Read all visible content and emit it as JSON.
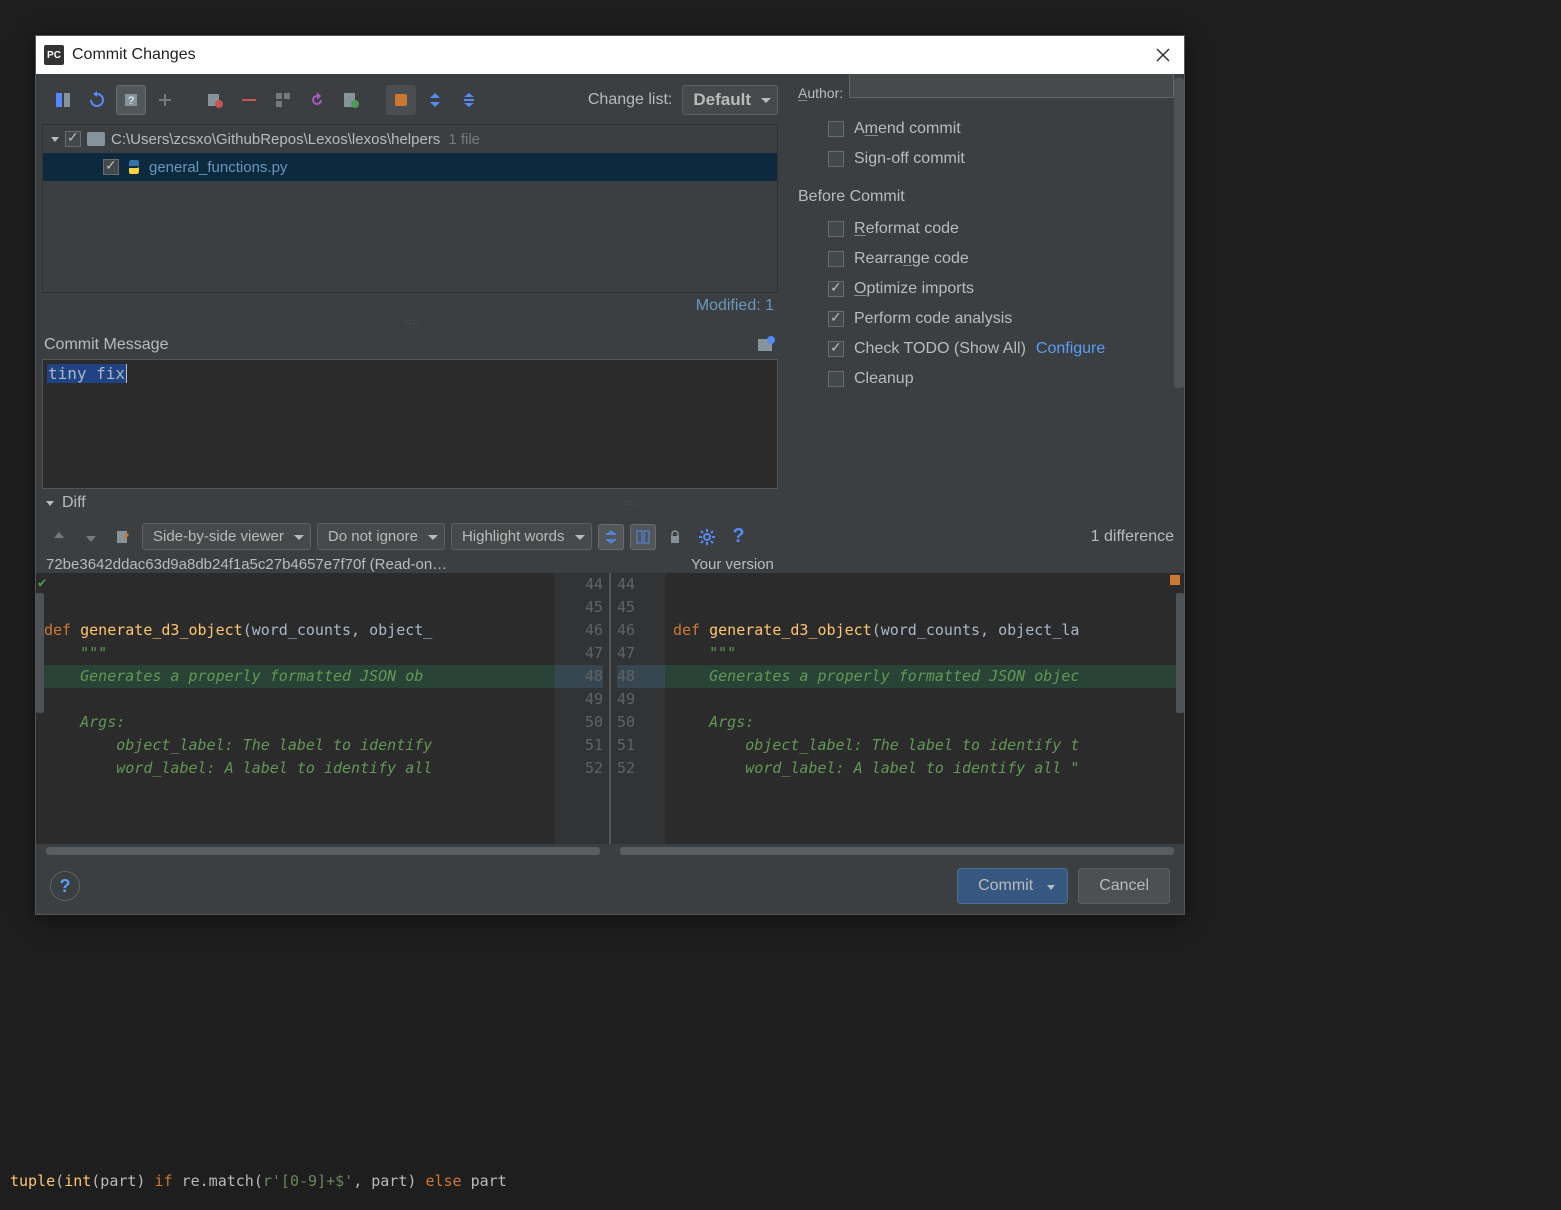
{
  "dialog": {
    "title": "Commit Changes",
    "changelist_label": "Change list:",
    "changelist_value": "Default"
  },
  "tree": {
    "folder_path": "C:\\Users\\zcsxo\\GithubRepos\\Lexos\\lexos\\helpers",
    "file_count": "1 file",
    "file_name": "general_functions.py",
    "modified": "Modified: 1"
  },
  "commit_message": {
    "label": "Commit Message",
    "value": "tiny fix"
  },
  "right": {
    "author_label": "Author:",
    "amend": "Amend commit",
    "signoff": "Sign-off commit",
    "before_commit": "Before Commit",
    "reformat": "Reformat code",
    "rearrange": "Rearrange code",
    "optimize": "Optimize imports",
    "analysis": "Perform code analysis",
    "todo": "Check TODO (Show All)",
    "configure": "Configure",
    "cleanup": "Cleanup"
  },
  "diff": {
    "title": "Diff",
    "viewer_mode": "Side-by-side viewer",
    "ignore_mode": "Do not ignore",
    "highlight_mode": "Highlight words",
    "count": "1 difference",
    "left_header": "72be3642ddac63d9a8db24f1a5c27b4657e7f70f (Read-on…",
    "right_header": "Your version",
    "lines": [
      "44",
      "45",
      "46",
      "47",
      "48",
      "49",
      "50",
      "51",
      "52"
    ]
  },
  "code": {
    "def": "def",
    "fn_name": "generate_d3_object",
    "params_l": "(word_counts, object_",
    "params_r": "(word_counts, object_la",
    "triple_q": "\"\"\"",
    "docline_l": "Generates a properly formatted JSON ob",
    "docline_r": "Generates a properly formatted JSON objec",
    "args": "Args:",
    "obj_label_l": "object_label: The label to identify",
    "obj_label_r": "object_label: The label to identify t",
    "word_label_l": "word_label: A label to identify all",
    "word_label_r": "word_label: A label to identify all \""
  },
  "buttons": {
    "help": "?",
    "commit": "Commit",
    "cancel": "Cancel"
  },
  "bg_bottom": "tuple(int(part) if re.match(r'[0-9]+$', part) else part"
}
